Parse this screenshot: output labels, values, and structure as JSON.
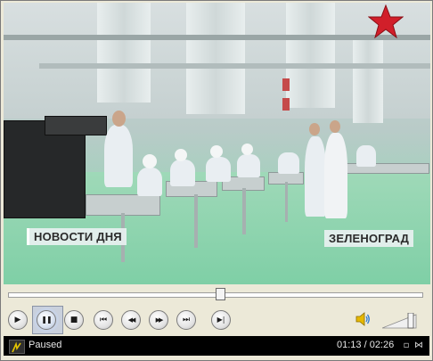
{
  "video": {
    "caption_left": "НОВОСТИ ДНЯ",
    "caption_right": "ЗЕЛЕНОГРАД",
    "channel_logo": "red-star-icon"
  },
  "controls": {
    "buttons": [
      {
        "name": "play-button",
        "icon": "play-icon",
        "glyph": "▶"
      },
      {
        "name": "pause-button",
        "icon": "pause-icon",
        "glyph": "❚❚",
        "active": true
      },
      {
        "name": "stop-button",
        "icon": "stop-icon",
        "glyph": "■"
      },
      {
        "name": "previous-button",
        "icon": "skip-back-icon",
        "glyph": "⏮"
      },
      {
        "name": "rewind-button",
        "icon": "rewind-icon",
        "glyph": "◀◀"
      },
      {
        "name": "fast-forward-button",
        "icon": "fast-forward-icon",
        "glyph": "▶▶"
      },
      {
        "name": "next-button",
        "icon": "skip-forward-icon",
        "glyph": "⏭"
      },
      {
        "name": "frame-step-button",
        "icon": "frame-step-icon",
        "glyph": "▶|"
      }
    ],
    "seek_fraction": 0.513
  },
  "status": {
    "state": "Paused",
    "time": "01:13 / 02:26"
  },
  "colors": {
    "status_bg": "#000000",
    "floor": "#8fd2b0",
    "logo_star": "#d11f2a"
  }
}
